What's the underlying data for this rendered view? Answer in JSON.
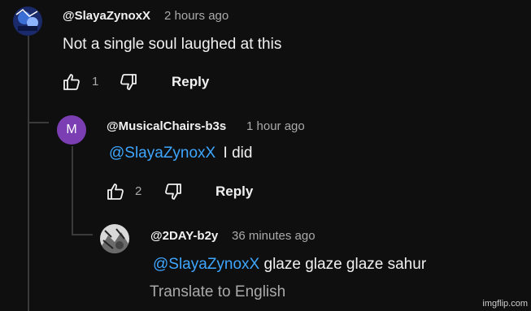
{
  "comments": [
    {
      "handle": "@SlayaZynoxX",
      "time": "2 hours ago",
      "text": "Not a single soul laughed at this",
      "likes": "1",
      "reply_label": "Reply"
    },
    {
      "handle": "@MusicalChairs-b3s",
      "time": "1 hour ago",
      "avatar_letter": "M",
      "avatar_color": "#7b3fb3",
      "mention": "@SlayaZynoxX",
      "text": "I did",
      "likes": "2",
      "reply_label": "Reply"
    },
    {
      "handle": "@2DAY-b2y",
      "time": "36 minutes ago",
      "mention": "@SlayaZynoxX",
      "text": "glaze glaze glaze sahur",
      "translate_label": "Translate to English"
    }
  ],
  "colors": {
    "background": "#0f0f0f",
    "mention": "#3ea6ff",
    "secondary_text": "#aaaaaa"
  },
  "watermark": "imgflip.com"
}
